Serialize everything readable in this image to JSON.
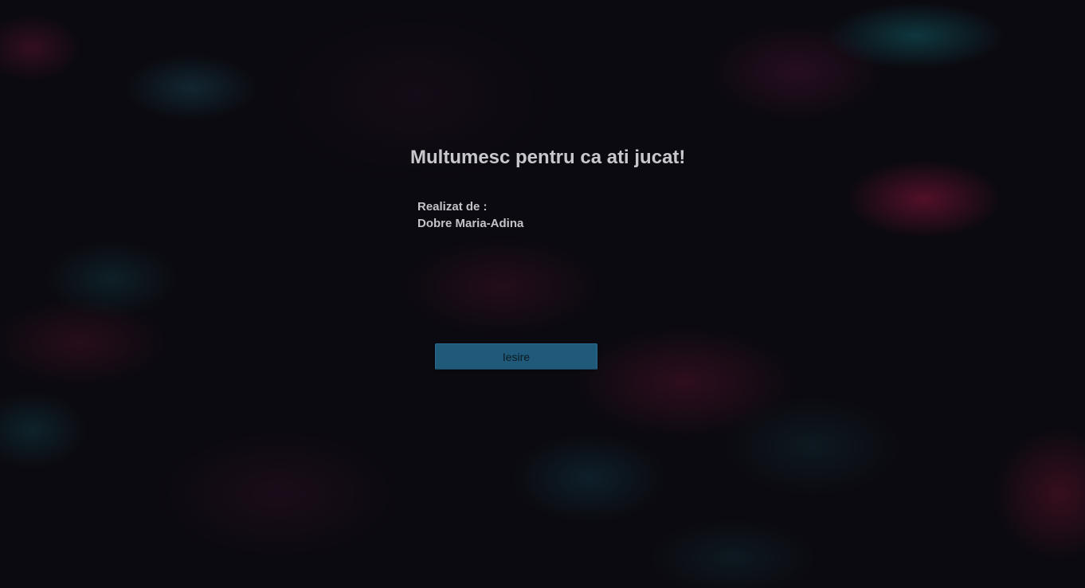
{
  "screen": {
    "title": "Multumesc pentru ca ati jucat!",
    "credits_label": "Realizat de :",
    "credits_name": "Dobre Maria-Adina",
    "exit_button_label": "Iesire"
  },
  "colors": {
    "text": "#c8c8cc",
    "button_background": "#1f5a7a",
    "button_text": "#0c1820",
    "background": "#0b0a10"
  }
}
